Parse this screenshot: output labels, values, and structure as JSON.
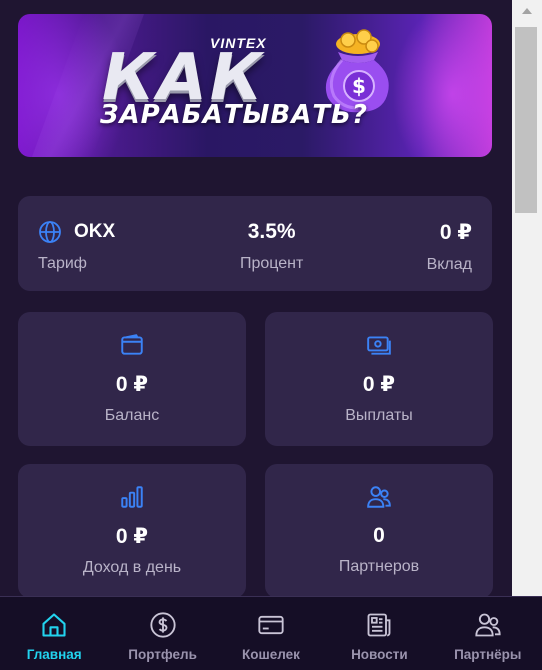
{
  "banner": {
    "brand": "VINTEX",
    "headline": "КАК",
    "subline": "ЗАРАБАТЫВАТЬ?"
  },
  "summary": {
    "tariff_value": "OKX",
    "tariff_label": "Тариф",
    "percent_value": "3.5%",
    "percent_label": "Процент",
    "deposit_value": "0 ₽",
    "deposit_label": "Вклад"
  },
  "cards": [
    {
      "icon": "wallet-icon",
      "value": "0 ₽",
      "label": "Баланс"
    },
    {
      "icon": "cash-icon",
      "value": "0 ₽",
      "label": "Выплаты"
    },
    {
      "icon": "bar-chart-icon",
      "value": "0 ₽",
      "label": "Доход в день"
    },
    {
      "icon": "users-icon",
      "value": "0",
      "label": "Партнеров"
    }
  ],
  "nav": [
    {
      "icon": "home-icon",
      "label": "Главная",
      "active": true
    },
    {
      "icon": "dollar-circle-icon",
      "label": "Портфель",
      "active": false
    },
    {
      "icon": "card-icon",
      "label": "Кошелек",
      "active": false
    },
    {
      "icon": "newspaper-icon",
      "label": "Новости",
      "active": false
    },
    {
      "icon": "partners-icon",
      "label": "Партнёры",
      "active": false
    }
  ],
  "colors": {
    "background": "#1f1531",
    "card": "#31264a",
    "accent": "#22d3ee",
    "icon": "#3b82f6",
    "nav_bg": "#150e26"
  }
}
